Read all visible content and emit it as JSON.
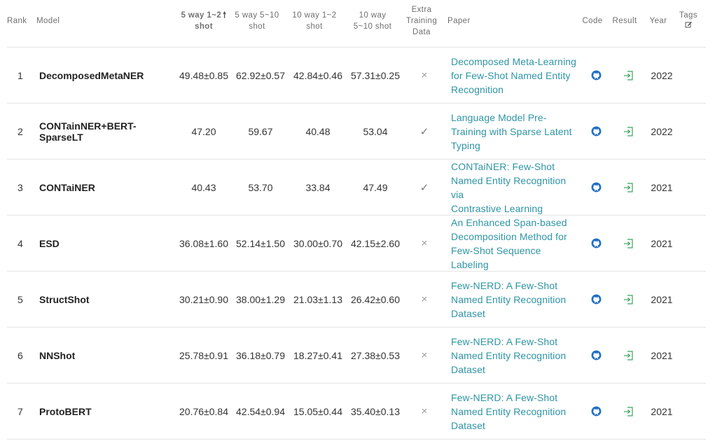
{
  "headers": {
    "rank": "Rank",
    "model": "Model",
    "col1_line1": "5 way 1~2",
    "col1_arrow": "🠕",
    "col1_line2": "shot",
    "col2_line1": "5 way 5~10",
    "col2_line2": "shot",
    "col3_line1": "10 way 1~2",
    "col3_line2": "shot",
    "col4_line1": "10 way",
    "col4_line2": "5~10 shot",
    "extra_line1": "Extra",
    "extra_line2": "Training",
    "extra_line3": "Data",
    "paper": "Paper",
    "code": "Code",
    "result": "Result",
    "year": "Year",
    "tags": "Tags"
  },
  "icons": {
    "code": "github-icon",
    "result": "enter-icon",
    "tags": "edit-icon"
  },
  "colors": {
    "link": "#2f95a5",
    "code_icon": "#1f6fc5",
    "result_icon": "#3aa55a"
  },
  "rows": [
    {
      "rank": "1",
      "model": "DecomposedMetaNER",
      "v1": "49.48±0.85",
      "v2": "62.92±0.57",
      "v3": "42.84±0.46",
      "v4": "57.31±0.25",
      "extra": "×",
      "paper": [
        "Decomposed Meta-Learning",
        "for Few-Shot Named Entity",
        "Recognition"
      ],
      "year": "2022"
    },
    {
      "rank": "2",
      "model": "CONTainNER+BERT-SparseLT",
      "v1": "47.20",
      "v2": "59.67",
      "v3": "40.48",
      "v4": "53.04",
      "extra": "✓",
      "paper": [
        "Language Model Pre-",
        "Training with Sparse Latent",
        "Typing"
      ],
      "year": "2022"
    },
    {
      "rank": "3",
      "model": "CONTaiNER",
      "v1": "40.43",
      "v2": "53.70",
      "v3": "33.84",
      "v4": "47.49",
      "extra": "✓",
      "paper": [
        "CONTaiNER: Few-Shot",
        "Named Entity Recognition via",
        "Contrastive Learning"
      ],
      "year": "2021"
    },
    {
      "rank": "4",
      "model": "ESD",
      "v1": "36.08±1.60",
      "v2": "52.14±1.50",
      "v3": "30.00±0.70",
      "v4": "42.15±2.60",
      "extra": "×",
      "paper": [
        "An Enhanced Span-based",
        "Decomposition Method for",
        "Few-Shot Sequence Labeling"
      ],
      "year": "2021"
    },
    {
      "rank": "5",
      "model": "StructShot",
      "v1": "30.21±0.90",
      "v2": "38.00±1.29",
      "v3": "21.03±1.13",
      "v4": "26.42±0.60",
      "extra": "×",
      "paper": [
        "Few-NERD: A Few-Shot",
        "Named Entity Recognition",
        "Dataset"
      ],
      "year": "2021"
    },
    {
      "rank": "6",
      "model": "NNShot",
      "v1": "25.78±0.91",
      "v2": "36.18±0.79",
      "v3": "18.27±0.41",
      "v4": "27.38±0.53",
      "extra": "×",
      "paper": [
        "Few-NERD: A Few-Shot",
        "Named Entity Recognition",
        "Dataset"
      ],
      "year": "2021"
    },
    {
      "rank": "7",
      "model": "ProtoBERT",
      "v1": "20.76±0.84",
      "v2": "42.54±0.94",
      "v3": "15.05±0.44",
      "v4": "35.40±0.13",
      "extra": "×",
      "paper": [
        "Few-NERD: A Few-Shot",
        "Named Entity Recognition",
        "Dataset"
      ],
      "year": "2021"
    }
  ]
}
